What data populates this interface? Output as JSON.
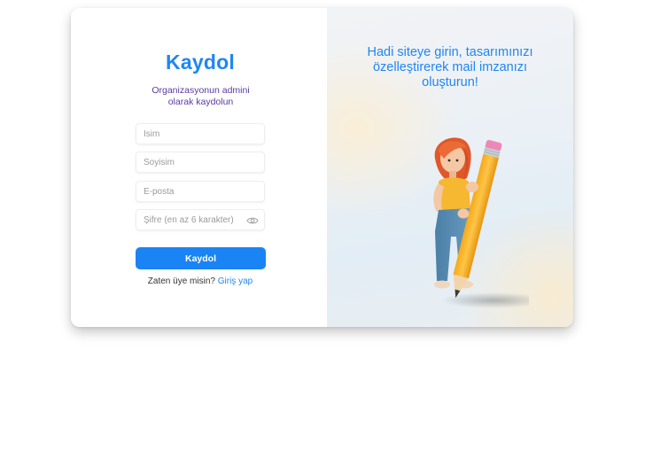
{
  "signup": {
    "title": "Kaydol",
    "subtitle": "Organizasyonun admini olarak kaydolun",
    "fields": {
      "first_name": {
        "placeholder": "İsim",
        "value": ""
      },
      "last_name": {
        "placeholder": "Soyisim",
        "value": ""
      },
      "email": {
        "placeholder": "E-posta",
        "value": ""
      },
      "password": {
        "placeholder": "Şifre (en az 6 karakter)",
        "value": ""
      }
    },
    "password_toggle_icon": "eye-icon",
    "submit_label": "Kaydol",
    "login_prompt": "Zaten üye misin?",
    "login_link": "Giriş yap"
  },
  "promo": {
    "headline": "Hadi siteye girin, tasarımınızı özelleştirerek mail imzanızı oluşturun!",
    "illustration": "girl-holding-pencil"
  },
  "colors": {
    "accent": "#1f86f2",
    "button": "#1a84f5",
    "subtitle": "#5a3aa0"
  }
}
